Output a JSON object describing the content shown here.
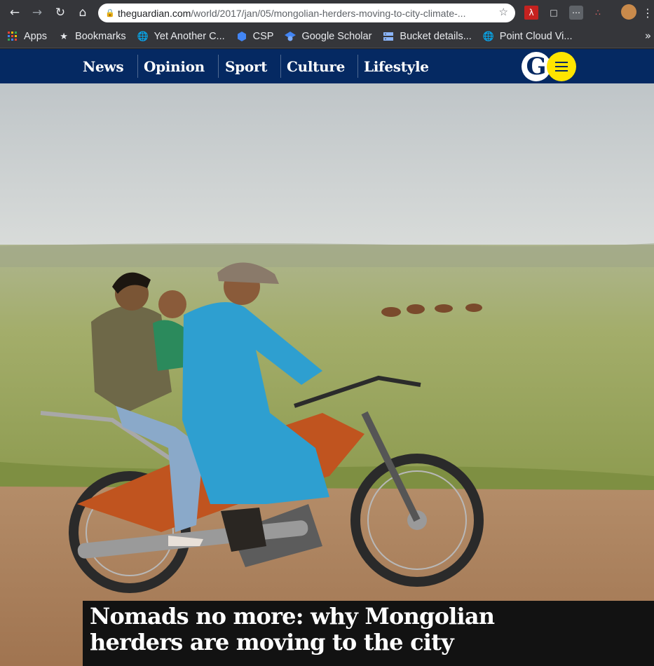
{
  "browser": {
    "url_domain": "theguardian.com",
    "url_path": "/world/2017/jan/05/mongolian-herders-moving-to-city-climate-..."
  },
  "bookmarks": {
    "items": [
      {
        "label": "Apps",
        "icon": "apps-grid-icon"
      },
      {
        "label": "Bookmarks",
        "icon": "star-icon"
      },
      {
        "label": "Yet Another C...",
        "icon": "globe-icon"
      },
      {
        "label": "CSP",
        "icon": "hexagon-icon"
      },
      {
        "label": "Google Scholar",
        "icon": "scholar-cap-icon"
      },
      {
        "label": "Bucket details...",
        "icon": "storage-icon"
      },
      {
        "label": "Point Cloud Vi...",
        "icon": "globe-icon"
      }
    ],
    "overflow": "»"
  },
  "guardian_nav": {
    "items": [
      "News",
      "Opinion",
      "Sport",
      "Culture",
      "Lifestyle"
    ],
    "logo_letter": "G"
  },
  "article": {
    "headline": "Nomads no more: why Mongolian herders are moving to the city"
  },
  "colors": {
    "guardian_blue": "#052962",
    "guardian_yellow": "#ffe500",
    "headline_bg": "#121212"
  }
}
